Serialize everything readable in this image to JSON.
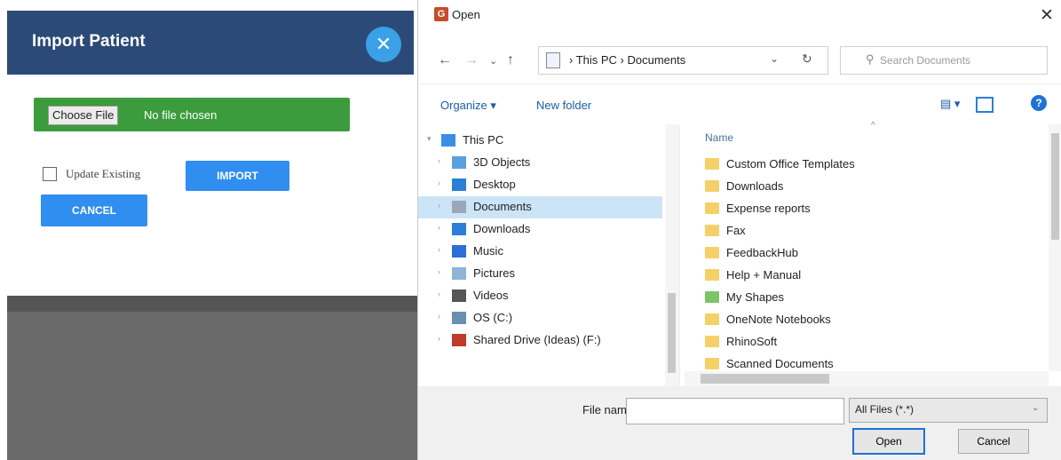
{
  "app": {
    "modal_title": "Import Patient",
    "close_glyph": "✕",
    "choose_file_label": "Choose File",
    "no_file_text": "No file chosen",
    "update_label": "Update Existing",
    "import_label": "IMPORT",
    "cancel_label": "CANCEL",
    "header_color": "#2b4a78",
    "accent": "#2f8ef0"
  },
  "dialog": {
    "title": "Open",
    "close_glyph": "✕",
    "nav": {
      "back": "←",
      "forward": "→",
      "recent": "⌄",
      "up": "↑"
    },
    "address": {
      "path": "› This PC  ›  Documents",
      "dropdown": "⌄",
      "refresh": "↻"
    },
    "search": {
      "placeholder": "Search Documents",
      "icon": "⚲"
    },
    "toolbar": {
      "organize": "Organize ▾",
      "new_folder": "New folder",
      "view": "▤ ▾",
      "help": "?"
    },
    "nav_items": [
      {
        "label": "This PC",
        "icon": "pc-icon",
        "top": true
      },
      {
        "label": "3D Objects",
        "icon": "cube-icon"
      },
      {
        "label": "Desktop",
        "icon": "desktop-icon"
      },
      {
        "label": "Documents",
        "icon": "documents-icon",
        "selected": true
      },
      {
        "label": "Downloads",
        "icon": "downloads-icon"
      },
      {
        "label": "Music",
        "icon": "music-icon"
      },
      {
        "label": "Pictures",
        "icon": "pictures-icon"
      },
      {
        "label": "Videos",
        "icon": "videos-icon"
      },
      {
        "label": "OS (C:)",
        "icon": "drive-icon"
      },
      {
        "label": "Shared Drive (Ideas) (F:)",
        "icon": "network-drive-icon"
      }
    ],
    "column_header": "Name",
    "sort_arrow": "^",
    "files": [
      "Custom Office Templates",
      "Downloads",
      "Expense reports",
      "Fax",
      "FeedbackHub",
      "Help + Manual",
      "My Shapes",
      "OneNote Notebooks",
      "RhinoSoft",
      "Scanned Documents"
    ],
    "filename_label": "File name:",
    "filename_value": "",
    "filter_value": "All Files (*.*)",
    "filter_arrow": "⌄",
    "open_label": "Open",
    "cancel_label": "Cancel"
  }
}
